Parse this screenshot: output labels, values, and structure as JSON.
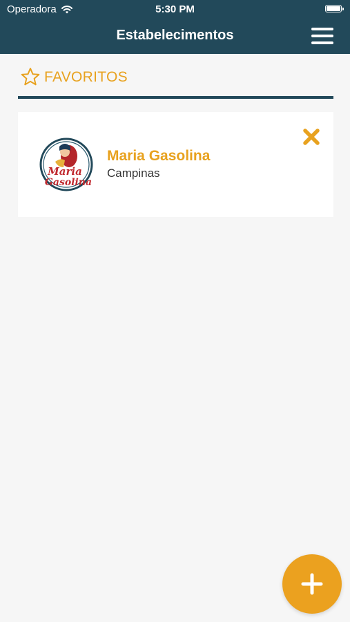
{
  "status_bar": {
    "carrier": "Operadora",
    "time": "5:30 PM"
  },
  "header": {
    "title": "Estabelecimentos"
  },
  "favorites": {
    "section_title": "FAVORITOS",
    "items": [
      {
        "name": "Maria Gasolina",
        "city": "Campinas",
        "logo_text": "Maria Gasolina"
      }
    ]
  },
  "colors": {
    "header_bg": "#22495a",
    "accent": "#e8a21f",
    "fab": "#eba11f",
    "background": "#f6f6f6"
  },
  "icons": {
    "menu": "hamburger-menu-icon",
    "favorites": "star-outline-icon",
    "remove": "close-x-icon",
    "add": "plus-icon"
  }
}
